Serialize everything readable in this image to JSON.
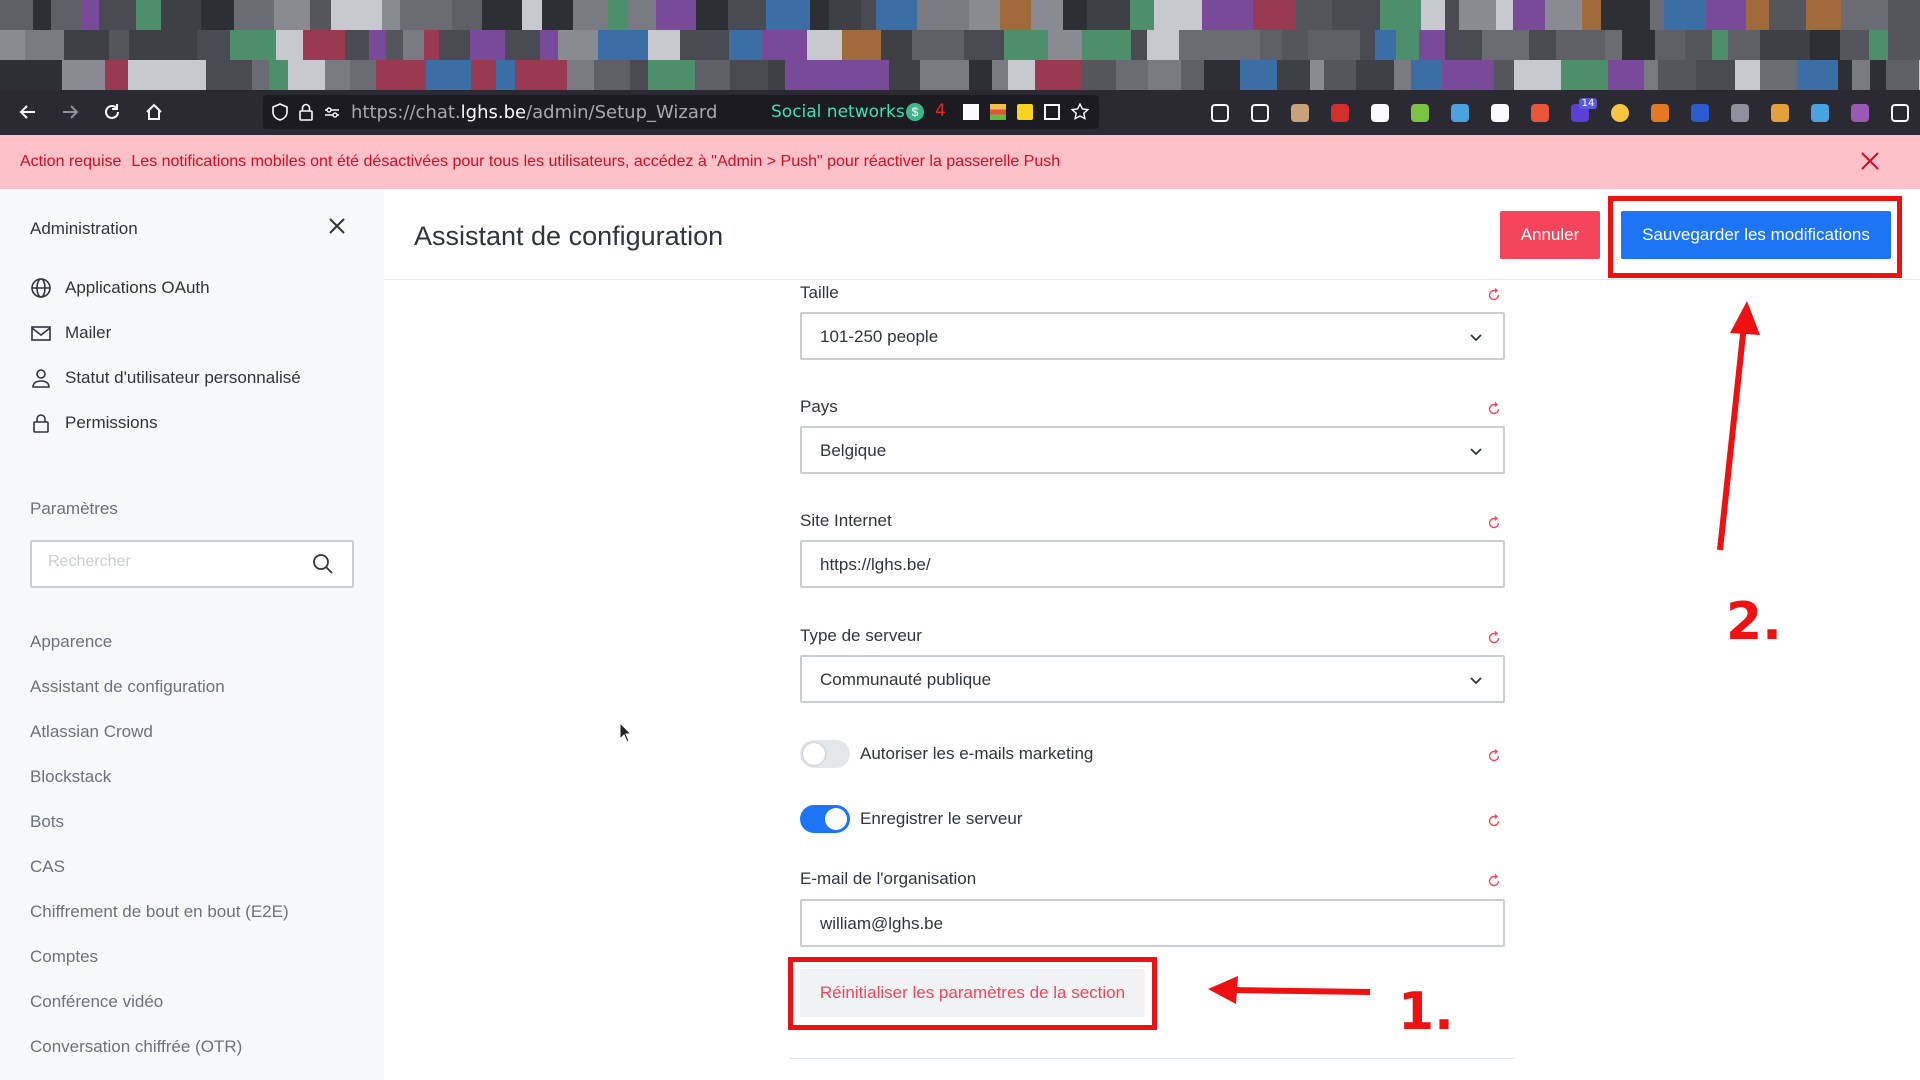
{
  "browser": {
    "url_prefix": "https://chat.",
    "url_host": "lghs.be",
    "url_path": "/admin/Setup_Wizard",
    "social_label": "Social networks",
    "ext_badge_count": "14",
    "social_count": "4"
  },
  "banner": {
    "title": "Action requise",
    "message": "Les notifications mobiles ont été désactivées pour tous les utilisateurs, accédez à \"Admin > Push\" pour réactiver la passerelle Push"
  },
  "sidebar": {
    "title": "Administration",
    "items": [
      {
        "label": "Applications OAuth",
        "icon": "globe-icon"
      },
      {
        "label": "Mailer",
        "icon": "mail-icon"
      },
      {
        "label": "Statut d'utilisateur personnalisé",
        "icon": "user-icon"
      },
      {
        "label": "Permissions",
        "icon": "lock-icon"
      }
    ],
    "section_label": "Paramètres",
    "search_placeholder": "Rechercher",
    "links": [
      "Apparence",
      "Assistant de configuration",
      "Atlassian Crowd",
      "Blockstack",
      "Bots",
      "CAS",
      "Chiffrement de bout en bout (E2E)",
      "Comptes",
      "Conférence vidéo",
      "Conversation chiffrée (OTR)"
    ]
  },
  "main": {
    "title": "Assistant de configuration",
    "cancel_label": "Annuler",
    "save_label": "Sauvegarder les modifications",
    "fields": {
      "size": {
        "label": "Taille",
        "value": "101-250 people"
      },
      "country": {
        "label": "Pays",
        "value": "Belgique"
      },
      "website": {
        "label": "Site Internet",
        "value": "https://lghs.be/"
      },
      "server_type": {
        "label": "Type de serveur",
        "value": "Communauté publique"
      },
      "marketing": {
        "label": "Autoriser les e-mails marketing",
        "enabled": false
      },
      "register": {
        "label": "Enregistrer le serveur",
        "enabled": true
      },
      "email": {
        "label": "E-mail de l'organisation",
        "value": "william@lghs.be"
      }
    },
    "reset_section_label": "Réinitialiser les paramètres de la section"
  },
  "annotations": {
    "step1": "1.",
    "step2": "2.",
    "color": "#ee1111"
  },
  "colors": {
    "primary": "#1d74f5",
    "danger": "#f5455c",
    "banner_bg": "#ffc1c8"
  }
}
